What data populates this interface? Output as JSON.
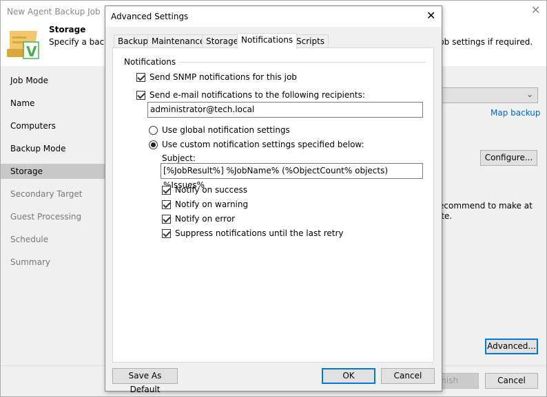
{
  "wizard": {
    "title": "New Agent Backup Job",
    "step_title": "Storage",
    "step_desc": "Specify a backu",
    "step_desc_tail": "job settings if required.",
    "link_map_backup": "Map backup",
    "configure": "Configure...",
    "recommend_line1": "ecommend to make at",
    "recommend_line2": "ite.",
    "advanced": "Advanced...",
    "finish": "Finish",
    "cancel": "Cancel",
    "steps": [
      {
        "label": "Job Mode",
        "state": "normal"
      },
      {
        "label": "Name",
        "state": "normal"
      },
      {
        "label": "Computers",
        "state": "normal"
      },
      {
        "label": "Backup Mode",
        "state": "normal"
      },
      {
        "label": "Storage",
        "state": "selected"
      },
      {
        "label": "Secondary Target",
        "state": "dim"
      },
      {
        "label": "Guest Processing",
        "state": "dim"
      },
      {
        "label": "Schedule",
        "state": "dim"
      },
      {
        "label": "Summary",
        "state": "dim"
      }
    ]
  },
  "dialog": {
    "title": "Advanced Settings",
    "tabs": [
      "Backup",
      "Maintenance",
      "Storage",
      "Notifications",
      "Scripts"
    ],
    "active_tab": "Notifications",
    "group_label": "Notifications",
    "snmp": {
      "label": "Send SNMP notifications for this job",
      "checked": true
    },
    "email": {
      "label": "Send e-mail notifications to the following recipients:",
      "checked": true,
      "value": "administrator@tech.local"
    },
    "radio_global": {
      "label": "Use global notification settings",
      "selected": false
    },
    "radio_custom": {
      "label": "Use custom notification settings specified below:",
      "selected": true
    },
    "subject_label": "Subject:",
    "subject_value": "[%JobResult%] %JobName% (%ObjectCount% objects) %Issues%",
    "options": [
      {
        "label": "Notify on success",
        "checked": true
      },
      {
        "label": "Notify on warning",
        "checked": true
      },
      {
        "label": "Notify on error",
        "checked": true
      },
      {
        "label": "Suppress notifications until the last retry",
        "checked": true
      }
    ],
    "save_default": "Save As Default",
    "ok": "OK",
    "cancel": "Cancel"
  },
  "colors": {
    "link": "#0066cc",
    "focus": "#0078d7",
    "selected_step": "#c8c8c8"
  }
}
